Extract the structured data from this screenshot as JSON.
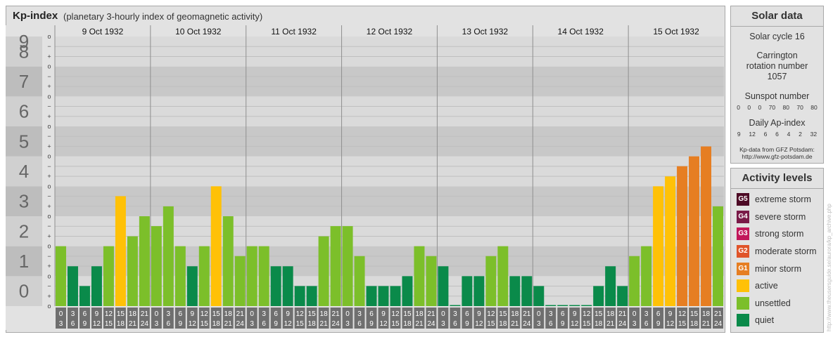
{
  "header": {
    "title": "Kp-index",
    "subtitle": "(planetary 3-hourly index of geomagnetic activity)"
  },
  "y_levels": [
    "0",
    "1",
    "2",
    "3",
    "4",
    "5",
    "6",
    "7",
    "8",
    "9"
  ],
  "y_minor_labels": [
    "o",
    "+",
    "−",
    "o"
  ],
  "chart_data": {
    "type": "bar",
    "title": "Kp-index",
    "subtitle": "(planetary 3-hourly index of geomagnetic activity)",
    "ylim": [
      0,
      9
    ],
    "days": [
      "9 Oct 1932",
      "10 Oct 1932",
      "11 Oct 1932",
      "12 Oct 1932",
      "13 Oct 1932",
      "14 Oct 1932",
      "15 Oct 1932"
    ],
    "interval_start_labels": [
      "0",
      "3",
      "6",
      "9",
      "12",
      "15",
      "18",
      "21"
    ],
    "interval_end_labels": [
      "3",
      "6",
      "9",
      "12",
      "15",
      "18",
      "21",
      "24"
    ],
    "values": [
      2,
      1.33,
      0.67,
      1.33,
      2,
      3.67,
      2.33,
      3,
      2.67,
      3.33,
      2,
      1.33,
      2,
      4,
      3,
      1.67,
      2,
      2,
      1.33,
      1.33,
      0.67,
      0.67,
      2.33,
      2.67,
      2.67,
      1.67,
      0.67,
      0.67,
      0.67,
      1,
      2,
      1.67,
      1.33,
      0,
      1,
      1,
      1.67,
      2,
      1,
      1,
      0.67,
      0,
      0,
      0,
      0,
      0.67,
      1.33,
      0.67,
      1.67,
      2,
      4,
      4.33,
      4.67,
      5,
      5.33,
      3.33
    ],
    "last_value": 4
  },
  "solar": {
    "heading": "Solar data",
    "cycle": "Solar cycle 16",
    "carrington": "Carrington rotation number 1057",
    "sunspot_heading": "Sunspot number",
    "sunspot_values": [
      "0",
      "0",
      "0",
      "70",
      "80",
      "70",
      "80"
    ],
    "ap_heading": "Daily Ap-index",
    "ap_values": [
      "9",
      "12",
      "6",
      "6",
      "4",
      "2",
      "32"
    ],
    "source_line1": "Kp-data from GFZ Potsdam:",
    "source_line2": "http://www.gfz-potsdam.de"
  },
  "activity": {
    "heading": "Activity levels",
    "items": [
      {
        "code": "G5",
        "label": "extreme storm",
        "color": "#4d0a25"
      },
      {
        "code": "G4",
        "label": "severe storm",
        "color": "#7a1a48"
      },
      {
        "code": "G3",
        "label": "strong storm",
        "color": "#c2185b"
      },
      {
        "code": "G2",
        "label": "moderate storm",
        "color": "#e0542a"
      },
      {
        "code": "G1",
        "label": "minor storm",
        "color": "#e67e22"
      },
      {
        "code": "",
        "label": "active",
        "color": "#ffc107"
      },
      {
        "code": "",
        "label": "unsettled",
        "color": "#7cbf2a"
      },
      {
        "code": "",
        "label": "quiet",
        "color": "#0a8a4a"
      }
    ]
  },
  "credit": "http://www.theusersguide.se/aurora/kp_archive.php"
}
